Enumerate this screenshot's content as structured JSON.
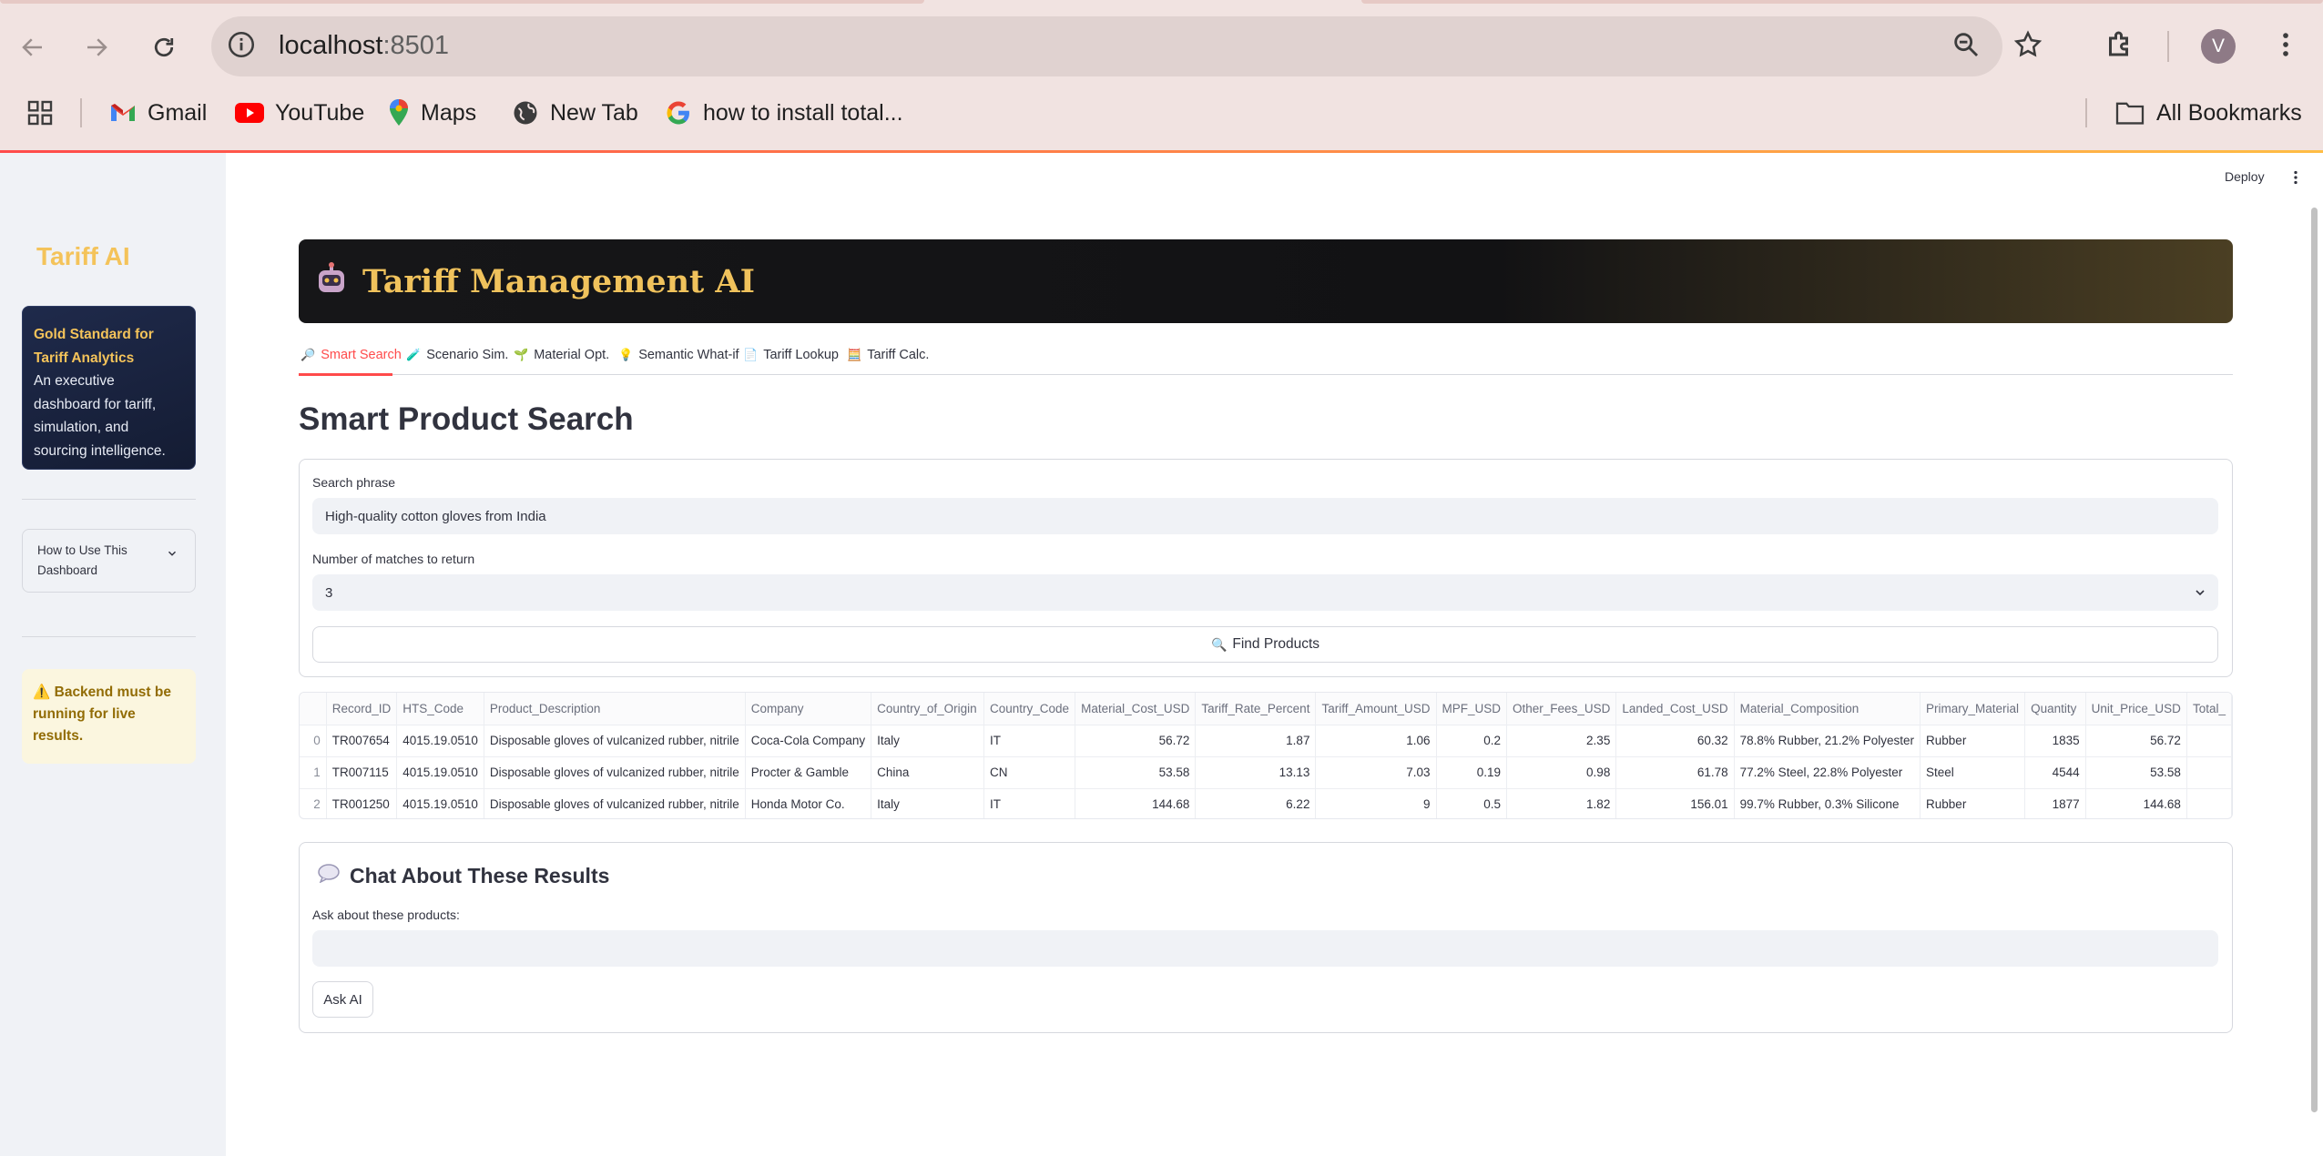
{
  "browser": {
    "url_host": "localhost",
    "url_port": ":8501",
    "profile_initial": "V",
    "bookmarks": [
      {
        "label": "Gmail",
        "icon": "gmail-icon"
      },
      {
        "label": "YouTube",
        "icon": "youtube-icon"
      },
      {
        "label": "Maps",
        "icon": "maps-icon"
      },
      {
        "label": "New Tab",
        "icon": "globe-icon"
      },
      {
        "label": "how to install total...",
        "icon": "google-icon"
      }
    ],
    "all_bookmarks": "All Bookmarks"
  },
  "app": {
    "deploy_label": "Deploy"
  },
  "sidebar": {
    "title": "Tariff AI",
    "card_heading": "Gold Standard for Tariff Analytics",
    "card_body": "An executive dashboard for tariff, simulation, and sourcing intelligence.",
    "expander_label": "How to Use This Dashboard",
    "warning": "Backend must be running for live results."
  },
  "hero": {
    "title": "Tariff Management AI"
  },
  "tabs": [
    {
      "label": "Smart Search",
      "icon": "🔎",
      "active": true
    },
    {
      "label": "Scenario Sim.",
      "icon": "🧪"
    },
    {
      "label": "Material Opt.",
      "icon": "🌱"
    },
    {
      "label": "Semantic What-if",
      "icon": "💡"
    },
    {
      "label": "Tariff Lookup",
      "icon": "📄"
    },
    {
      "label": "Tariff Calc.",
      "icon": "🧮"
    }
  ],
  "search": {
    "heading": "Smart Product Search",
    "phrase_label": "Search phrase",
    "phrase_value": "High-quality cotton gloves from India",
    "matches_label": "Number of matches to return",
    "matches_value": "3",
    "find_button": "Find Products"
  },
  "results": {
    "columns": [
      "",
      "Record_ID",
      "HTS_Code",
      "Product_Description",
      "Company",
      "Country_of_Origin",
      "Country_Code",
      "Material_Cost_USD",
      "Tariff_Rate_Percent",
      "Tariff_Amount_USD",
      "MPF_USD",
      "Other_Fees_USD",
      "Landed_Cost_USD",
      "Material_Composition",
      "Primary_Material",
      "Quantity",
      "Unit_Price_USD",
      "Total_"
    ],
    "rows": [
      [
        "0",
        "TR007654",
        "4015.19.0510",
        "Disposable gloves of vulcanized rubber, nitrile",
        "Coca-Cola Company",
        "Italy",
        "IT",
        "56.72",
        "1.87",
        "1.06",
        "0.2",
        "2.35",
        "60.32",
        "78.8% Rubber, 21.2% Polyester",
        "Rubber",
        "1835",
        "56.72",
        ""
      ],
      [
        "1",
        "TR007115",
        "4015.19.0510",
        "Disposable gloves of vulcanized rubber, nitrile",
        "Procter & Gamble",
        "China",
        "CN",
        "53.58",
        "13.13",
        "7.03",
        "0.19",
        "0.98",
        "61.78",
        "77.2% Steel, 22.8% Polyester",
        "Steel",
        "4544",
        "53.58",
        ""
      ],
      [
        "2",
        "TR001250",
        "4015.19.0510",
        "Disposable gloves of vulcanized rubber, nitrile",
        "Honda Motor Co.",
        "Italy",
        "IT",
        "144.68",
        "6.22",
        "9",
        "0.5",
        "1.82",
        "156.01",
        "99.7% Rubber, 0.3% Silicone",
        "Rubber",
        "1877",
        "144.68",
        ""
      ]
    ]
  },
  "chat": {
    "title": "Chat About These Results",
    "ask_label": "Ask about these products:",
    "ask_placeholder": "",
    "ask_button": "Ask AI"
  }
}
